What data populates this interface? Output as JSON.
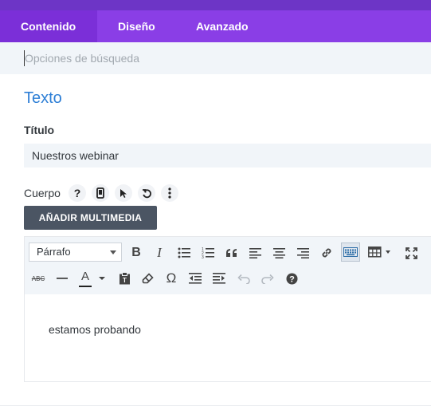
{
  "tabs": {
    "contenido": "Contenido",
    "diseno": "Diseño",
    "avanzado": "Avanzado"
  },
  "search": {
    "placeholder": "Opciones de búsqueda"
  },
  "section": {
    "title": "Texto"
  },
  "titulo": {
    "label": "Título",
    "value": "Nuestros webinar"
  },
  "cuerpo": {
    "label": "Cuerpo",
    "icons": [
      "help-icon",
      "mobile-icon",
      "cursor-icon",
      "reset-icon",
      "more-icon"
    ]
  },
  "media_button": {
    "label": "AÑADIR MULTIMEDIA"
  },
  "editor": {
    "format_select": "Párrafo",
    "content": "estamos probando",
    "toolbar_row1": [
      "bold",
      "italic",
      "bullet-list",
      "numbered-list",
      "blockquote",
      "align-left",
      "align-center",
      "align-right",
      "link",
      "keyboard",
      "table",
      "fullscreen"
    ],
    "toolbar_row2": [
      "strikethrough",
      "horizontal-line",
      "text-color",
      "paste-text",
      "clear-formatting",
      "special-character",
      "outdent",
      "indent",
      "undo",
      "redo",
      "help"
    ],
    "bold_glyph": "B",
    "italic_glyph": "I",
    "strike_glyph": "ABC",
    "color_glyph": "A",
    "omega_glyph": "Ω"
  },
  "colors": {
    "accent": "#8a3ee6",
    "active_tab": "#7b2fd8",
    "section_title": "#2e7fd6",
    "button": "#4b5563"
  }
}
